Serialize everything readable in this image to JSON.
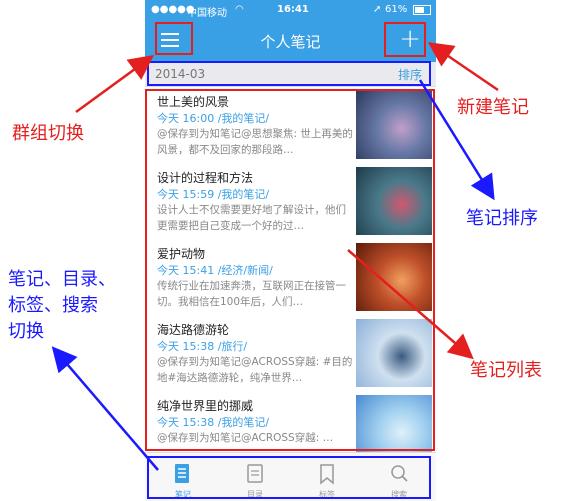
{
  "statusbar": {
    "carrier": "中国移动",
    "time": "16:41",
    "battery": "61%"
  },
  "navbar": {
    "title": "个人笔记",
    "add_label": "+"
  },
  "datebar": {
    "date": "2014-03",
    "sort_label": "排序"
  },
  "notes": [
    {
      "title": "世上美的风景",
      "meta": "今天 16:00  /我的笔记/",
      "preview": "@保存到为知笔记@思想聚焦: 世上再美的风景，都不及回家的那段路…",
      "thumb_colors": [
        "#2a3a5c",
        "#6a7aa8",
        "#c0a0c8"
      ]
    },
    {
      "title": "设计的过程和方法",
      "meta": "今天 15:59  /我的笔记/",
      "preview": "设计人士不仅需要更好地了解设计，他们更需要把自己变成一个好的过…",
      "thumb_colors": [
        "#1e3a4a",
        "#4a7a8a",
        "#d05870"
      ]
    },
    {
      "title": "爱护动物",
      "meta": "今天 15:41  /经济/新闻/",
      "preview": "传统行业在加速奔溃，互联网正在接管一切。我相信在100年后，人们…",
      "thumb_colors": [
        "#5a1a0a",
        "#c0502a",
        "#f0a060"
      ]
    },
    {
      "title": "海达路德游轮",
      "meta": "今天 15:38  /旅行/",
      "preview": "@保存到为知笔记@ACROSS穿越: #目的地#海达路德游轮，纯净世界…",
      "thumb_colors": [
        "#8ab0d8",
        "#d0e0f0",
        "#3a5a80"
      ]
    },
    {
      "title": "纯净世界里的挪威",
      "meta": "今天 15:38  /我的笔记/",
      "preview": "@保存到为知笔记@ACROSS穿越: …",
      "thumb_colors": [
        "#4a8ad0",
        "#a0d0f0",
        "#e0f0f8"
      ]
    }
  ],
  "tabs": [
    {
      "label": "笔记",
      "icon": "notes-icon",
      "active": true
    },
    {
      "label": "目录",
      "icon": "folder-icon",
      "active": false
    },
    {
      "label": "标签",
      "icon": "tag-icon",
      "active": false
    },
    {
      "label": "搜索",
      "icon": "search-icon",
      "active": false
    }
  ],
  "annotations": {
    "group_switch": "群组切换",
    "new_note": "新建笔记",
    "note_sort": "笔记排序",
    "nav_switch_line1": "笔记、目录、",
    "nav_switch_line2": "标签、搜索",
    "nav_switch_line3": "切换",
    "note_list": "笔记列表"
  },
  "colors": {
    "accent": "#3aa0e6",
    "annotation_red": "#e41f1f",
    "annotation_blue": "#1a1aff"
  }
}
